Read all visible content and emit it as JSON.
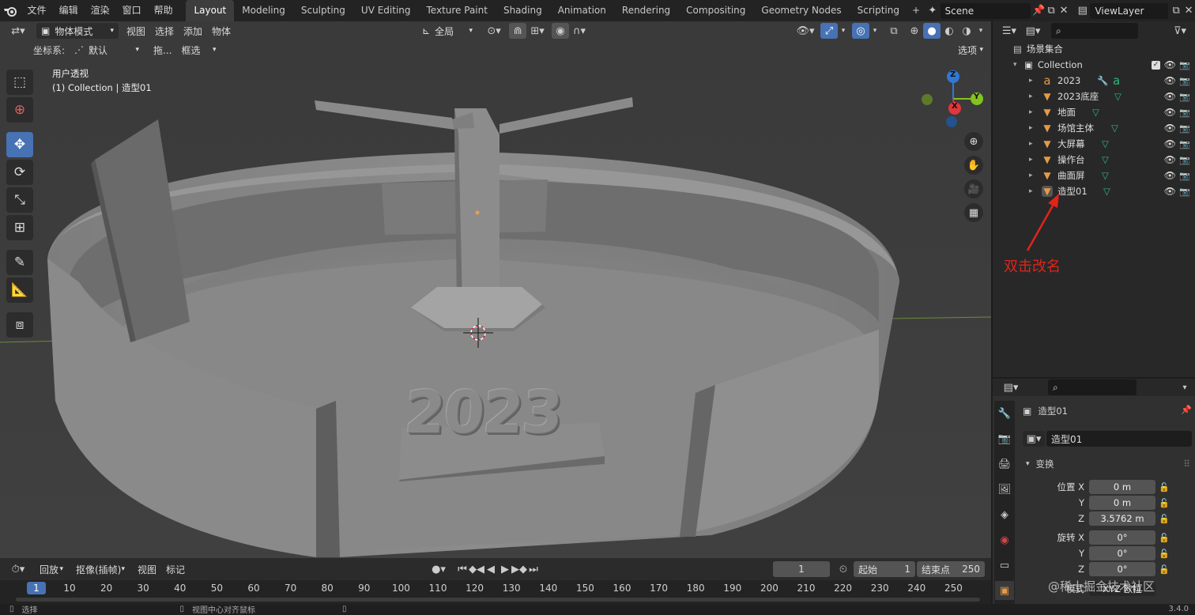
{
  "topbar": {
    "menus": [
      "文件",
      "编辑",
      "渲染",
      "窗口",
      "帮助"
    ],
    "workspaces": [
      "Layout",
      "Modeling",
      "Sculpting",
      "UV Editing",
      "Texture Paint",
      "Shading",
      "Animation",
      "Rendering",
      "Compositing",
      "Geometry Nodes",
      "Scripting"
    ],
    "active_workspace": "Layout",
    "add_tab": "+",
    "scene": "Scene",
    "view_layer": "ViewLayer"
  },
  "viewport_header": {
    "mode": "物体模式",
    "menus": [
      "视图",
      "选择",
      "添加",
      "物体"
    ],
    "transform_orientation": "全局",
    "coord_label": "坐标系:",
    "coord_value": "默认",
    "drag_label": "拖...",
    "drag_value": "框选",
    "options": "选项"
  },
  "viewport": {
    "view_name": "用户透视",
    "view_context": "(1) Collection | 造型01",
    "model_text": "2023",
    "gizmo_axes": {
      "z": "Z",
      "x": "X",
      "y": "Y"
    }
  },
  "outliner": {
    "scene_collection": "场景集合",
    "collection": "Collection",
    "items": [
      {
        "name": "2023",
        "icon": "text"
      },
      {
        "name": "2023底座",
        "icon": "mesh"
      },
      {
        "name": "地面",
        "icon": "mesh"
      },
      {
        "name": "场馆主体",
        "icon": "mesh"
      },
      {
        "name": "大屏幕",
        "icon": "mesh"
      },
      {
        "name": "操作台",
        "icon": "mesh"
      },
      {
        "name": "曲面屏",
        "icon": "mesh"
      },
      {
        "name": "造型01",
        "icon": "mesh"
      }
    ],
    "annotation": "双击改名",
    "annotation_color": "#e0241a"
  },
  "properties": {
    "object_name": "造型01",
    "object_field": "造型01",
    "section": "变换",
    "location": {
      "label_x": "位置 X",
      "label_y": "Y",
      "label_z": "Z",
      "x": "0 m",
      "y": "0 m",
      "z": "3.5762 m"
    },
    "rotation": {
      "label_x": "旋转 X",
      "label_y": "Y",
      "label_z": "Z",
      "x": "0°",
      "y": "0°",
      "z": "0°"
    },
    "mode_label": "模式",
    "mode_value": "XYZ 欧拉"
  },
  "timeline": {
    "playback": "回放",
    "keying": "抠像(插帧)",
    "view": "视图",
    "marker": "标记",
    "current_frame": "1",
    "start_label": "起始",
    "start": "1",
    "end_label": "结束点",
    "end": "250",
    "ruler": [
      "1",
      "10",
      "20",
      "30",
      "40",
      "50",
      "60",
      "70",
      "80",
      "90",
      "100",
      "110",
      "120",
      "130",
      "140",
      "150",
      "160",
      "170",
      "180",
      "190",
      "200",
      "210",
      "220",
      "230",
      "240",
      "250"
    ]
  },
  "statusbar": {
    "left": "选择",
    "mid": "视图中心对齐鼠标",
    "version": "3.4.0"
  },
  "watermark": "@稀土掘金技术社区",
  "colors": {
    "accent": "#4772b3",
    "mesh_icon": "#e59a47",
    "gizmo_x": "#e0363d",
    "gizmo_y": "#84c21f",
    "gizmo_z": "#2f78d6"
  }
}
